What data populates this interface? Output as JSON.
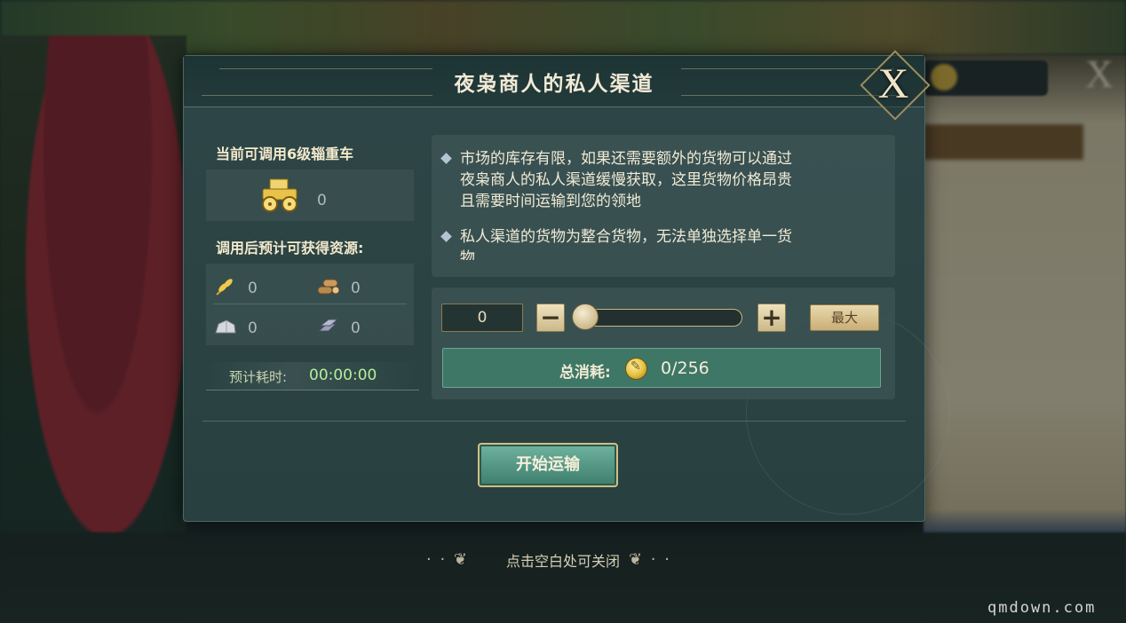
{
  "dialog": {
    "title": "夜枭商人的私人渠道",
    "close_icon": "X"
  },
  "left_panel": {
    "cart_label": "当前可调用6级辎重车",
    "cart_count": "0",
    "resources_label": "调用后预计可获得资源:",
    "resources": [
      {
        "icon": "wheat-icon",
        "value": "0"
      },
      {
        "icon": "wood-icon",
        "value": "0"
      },
      {
        "icon": "stone-icon",
        "value": "0"
      },
      {
        "icon": "iron-icon",
        "value": "0"
      }
    ],
    "time_label": "预计耗时:",
    "time_value": "00:00:00"
  },
  "info": {
    "lines": [
      "市场的库存有限，如果还需要额外的货物可以通过",
      "夜枭商人的私人渠道缓慢获取，这里货物价格昂贵",
      "且需要时间运输到您的领地",
      "私人渠道的货物为整合货物，无法单独选择单一货",
      "物"
    ]
  },
  "controls": {
    "quantity": "0",
    "minus_label": "−",
    "plus_label": "+",
    "max_label": "最大",
    "slider_fraction": 0,
    "cost_label": "总消耗:",
    "cost_value": "0/256"
  },
  "start_button_label": "开始运输",
  "dismiss_hint": "点击空白处可关闭",
  "watermark": "qmdown.com",
  "colors": {
    "accent_gold": "#d2bd86",
    "panel_teal": "#2e4647",
    "cost_green": "#3f7766",
    "time_green": "#b6ef9c"
  }
}
